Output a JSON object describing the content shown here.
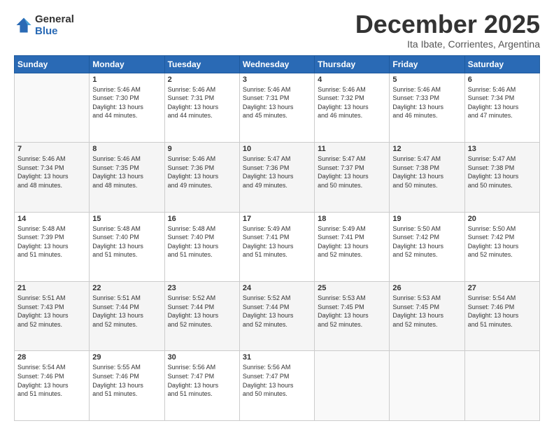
{
  "header": {
    "logo_line1": "General",
    "logo_line2": "Blue",
    "month_title": "December 2025",
    "subtitle": "Ita Ibate, Corrientes, Argentina"
  },
  "days_of_week": [
    "Sunday",
    "Monday",
    "Tuesday",
    "Wednesday",
    "Thursday",
    "Friday",
    "Saturday"
  ],
  "weeks": [
    [
      {
        "day": "",
        "info": ""
      },
      {
        "day": "1",
        "info": "Sunrise: 5:46 AM\nSunset: 7:30 PM\nDaylight: 13 hours\nand 44 minutes."
      },
      {
        "day": "2",
        "info": "Sunrise: 5:46 AM\nSunset: 7:31 PM\nDaylight: 13 hours\nand 44 minutes."
      },
      {
        "day": "3",
        "info": "Sunrise: 5:46 AM\nSunset: 7:31 PM\nDaylight: 13 hours\nand 45 minutes."
      },
      {
        "day": "4",
        "info": "Sunrise: 5:46 AM\nSunset: 7:32 PM\nDaylight: 13 hours\nand 46 minutes."
      },
      {
        "day": "5",
        "info": "Sunrise: 5:46 AM\nSunset: 7:33 PM\nDaylight: 13 hours\nand 46 minutes."
      },
      {
        "day": "6",
        "info": "Sunrise: 5:46 AM\nSunset: 7:34 PM\nDaylight: 13 hours\nand 47 minutes."
      }
    ],
    [
      {
        "day": "7",
        "info": "Sunrise: 5:46 AM\nSunset: 7:34 PM\nDaylight: 13 hours\nand 48 minutes."
      },
      {
        "day": "8",
        "info": "Sunrise: 5:46 AM\nSunset: 7:35 PM\nDaylight: 13 hours\nand 48 minutes."
      },
      {
        "day": "9",
        "info": "Sunrise: 5:46 AM\nSunset: 7:36 PM\nDaylight: 13 hours\nand 49 minutes."
      },
      {
        "day": "10",
        "info": "Sunrise: 5:47 AM\nSunset: 7:36 PM\nDaylight: 13 hours\nand 49 minutes."
      },
      {
        "day": "11",
        "info": "Sunrise: 5:47 AM\nSunset: 7:37 PM\nDaylight: 13 hours\nand 50 minutes."
      },
      {
        "day": "12",
        "info": "Sunrise: 5:47 AM\nSunset: 7:38 PM\nDaylight: 13 hours\nand 50 minutes."
      },
      {
        "day": "13",
        "info": "Sunrise: 5:47 AM\nSunset: 7:38 PM\nDaylight: 13 hours\nand 50 minutes."
      }
    ],
    [
      {
        "day": "14",
        "info": "Sunrise: 5:48 AM\nSunset: 7:39 PM\nDaylight: 13 hours\nand 51 minutes."
      },
      {
        "day": "15",
        "info": "Sunrise: 5:48 AM\nSunset: 7:40 PM\nDaylight: 13 hours\nand 51 minutes."
      },
      {
        "day": "16",
        "info": "Sunrise: 5:48 AM\nSunset: 7:40 PM\nDaylight: 13 hours\nand 51 minutes."
      },
      {
        "day": "17",
        "info": "Sunrise: 5:49 AM\nSunset: 7:41 PM\nDaylight: 13 hours\nand 51 minutes."
      },
      {
        "day": "18",
        "info": "Sunrise: 5:49 AM\nSunset: 7:41 PM\nDaylight: 13 hours\nand 52 minutes."
      },
      {
        "day": "19",
        "info": "Sunrise: 5:50 AM\nSunset: 7:42 PM\nDaylight: 13 hours\nand 52 minutes."
      },
      {
        "day": "20",
        "info": "Sunrise: 5:50 AM\nSunset: 7:42 PM\nDaylight: 13 hours\nand 52 minutes."
      }
    ],
    [
      {
        "day": "21",
        "info": "Sunrise: 5:51 AM\nSunset: 7:43 PM\nDaylight: 13 hours\nand 52 minutes."
      },
      {
        "day": "22",
        "info": "Sunrise: 5:51 AM\nSunset: 7:44 PM\nDaylight: 13 hours\nand 52 minutes."
      },
      {
        "day": "23",
        "info": "Sunrise: 5:52 AM\nSunset: 7:44 PM\nDaylight: 13 hours\nand 52 minutes."
      },
      {
        "day": "24",
        "info": "Sunrise: 5:52 AM\nSunset: 7:44 PM\nDaylight: 13 hours\nand 52 minutes."
      },
      {
        "day": "25",
        "info": "Sunrise: 5:53 AM\nSunset: 7:45 PM\nDaylight: 13 hours\nand 52 minutes."
      },
      {
        "day": "26",
        "info": "Sunrise: 5:53 AM\nSunset: 7:45 PM\nDaylight: 13 hours\nand 52 minutes."
      },
      {
        "day": "27",
        "info": "Sunrise: 5:54 AM\nSunset: 7:46 PM\nDaylight: 13 hours\nand 51 minutes."
      }
    ],
    [
      {
        "day": "28",
        "info": "Sunrise: 5:54 AM\nSunset: 7:46 PM\nDaylight: 13 hours\nand 51 minutes."
      },
      {
        "day": "29",
        "info": "Sunrise: 5:55 AM\nSunset: 7:46 PM\nDaylight: 13 hours\nand 51 minutes."
      },
      {
        "day": "30",
        "info": "Sunrise: 5:56 AM\nSunset: 7:47 PM\nDaylight: 13 hours\nand 51 minutes."
      },
      {
        "day": "31",
        "info": "Sunrise: 5:56 AM\nSunset: 7:47 PM\nDaylight: 13 hours\nand 50 minutes."
      },
      {
        "day": "",
        "info": ""
      },
      {
        "day": "",
        "info": ""
      },
      {
        "day": "",
        "info": ""
      }
    ]
  ]
}
